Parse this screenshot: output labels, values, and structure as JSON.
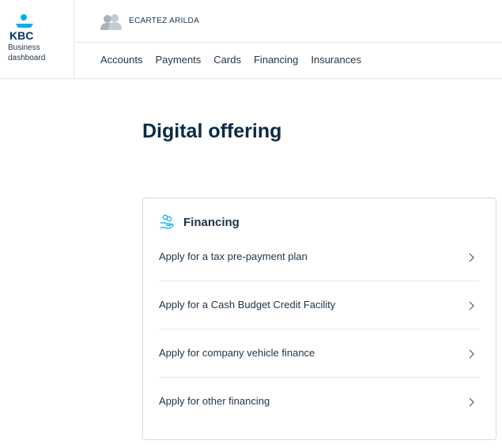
{
  "brand": {
    "logo_text": "KBC",
    "subtitle_line1": "Business",
    "subtitle_line2": "dashboard"
  },
  "user": {
    "name": "ECARTEZ ARILDA",
    "icon": "users-icon"
  },
  "nav": {
    "items": [
      {
        "label": "Accounts"
      },
      {
        "label": "Payments"
      },
      {
        "label": "Cards"
      },
      {
        "label": "Financing"
      },
      {
        "label": "Insurances"
      }
    ]
  },
  "page": {
    "title": "Digital offering"
  },
  "card": {
    "icon": "financing-hand-coins-icon",
    "title": "Financing",
    "items": [
      {
        "label": "Apply for a tax pre-payment plan"
      },
      {
        "label": "Apply for a Cash Budget Credit Facility"
      },
      {
        "label": "Apply for company vehicle finance"
      },
      {
        "label": "Apply for other financing"
      }
    ]
  },
  "colors": {
    "brand_blue": "#003665",
    "brand_cyan": "#00aeef",
    "text": "#1f3447",
    "border": "#d7dbdf"
  }
}
